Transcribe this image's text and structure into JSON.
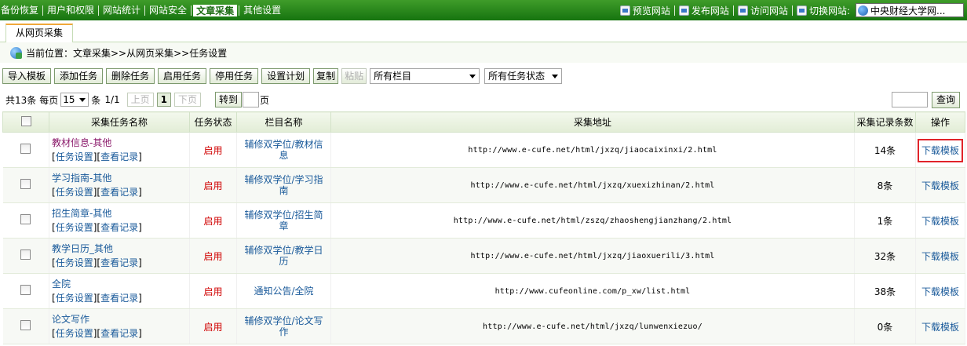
{
  "topnav": {
    "items": [
      "备份恢复",
      "用户和权限",
      "网站统计",
      "网站安全",
      "文章采集",
      "其他设置"
    ],
    "active_index": 4
  },
  "toplinks": {
    "preview": "预览网站",
    "publish": "发布网站",
    "visit": "访问网站",
    "switch": "切换网站:",
    "site": "中央财经大学网..."
  },
  "tab": {
    "label": "从网页采集"
  },
  "breadcrumb": {
    "text": "当前位置：文章采集>>从网页采集>>任务设置"
  },
  "toolbar": {
    "import": "导入模板",
    "add": "添加任务",
    "delete": "删除任务",
    "enable": "启用任务",
    "disable": "停用任务",
    "schedule": "设置计划",
    "copy": "复制",
    "paste": "粘贴",
    "column_select": "所有栏目",
    "status_select": "所有任务状态"
  },
  "pager": {
    "total": "共13条",
    "per_page_label": "每页",
    "per_page": "15",
    "unit": "条",
    "page_info": "1/1",
    "prev": "上页",
    "current": "1",
    "next": "下页",
    "goto": "转到",
    "page_suffix": "页",
    "search_btn": "查询"
  },
  "table": {
    "headers": [
      "采集任务名称",
      "任务状态",
      "栏目名称",
      "采集地址",
      "采集记录条数",
      "操作"
    ],
    "rows": [
      {
        "name": "教材信息-其他",
        "settings": "任务设置",
        "records": "查看记录",
        "status": "启用",
        "column": "辅修双学位/教材信息",
        "url": "http://www.e-cufe.net/html/jxzq/jiaocaixinxi/2.html",
        "count": "14条",
        "op": "下载模板"
      },
      {
        "name": "学习指南-其他",
        "settings": "任务设置",
        "records": "查看记录",
        "status": "启用",
        "column": "辅修双学位/学习指南",
        "url": "http://www.e-cufe.net/html/jxzq/xuexizhinan/2.html",
        "count": "8条",
        "op": "下载模板"
      },
      {
        "name": "招生简章-其他",
        "settings": "任务设置",
        "records": "查看记录",
        "status": "启用",
        "column": "辅修双学位/招生简章",
        "url": "http://www.e-cufe.net/html/zszq/zhaoshengjianzhang/2.html",
        "count": "1条",
        "op": "下载模板"
      },
      {
        "name": "教学日历_其他",
        "settings": "任务设置",
        "records": "查看记录",
        "status": "启用",
        "column": "辅修双学位/教学日历",
        "url": "http://www.e-cufe.net/html/jxzq/jiaoxuerili/3.html",
        "count": "32条",
        "op": "下载模板"
      },
      {
        "name": "全院",
        "settings": "任务设置",
        "records": "查看记录",
        "status": "启用",
        "column": "通知公告/全院",
        "url": "http://www.cufeonline.com/p_xw/list.html",
        "count": "38条",
        "op": "下载模板"
      },
      {
        "name": "论文写作",
        "settings": "任务设置",
        "records": "查看记录",
        "status": "启用",
        "column": "辅修双学位/论文写作",
        "url": "http://www.e-cufe.net/html/jxzq/lunwenxiezuo/",
        "count": "0条",
        "op": "下载模板"
      }
    ]
  }
}
